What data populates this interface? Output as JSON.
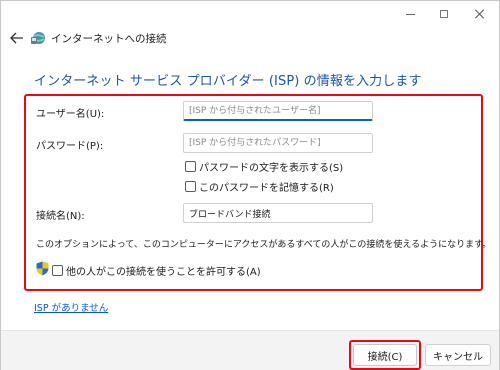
{
  "window": {
    "title": "インターネットへの接続"
  },
  "heading": "インターネット サービス プロバイダー (ISP) の情報を入力します",
  "form": {
    "username_label": "ユーザー名(U):",
    "username_placeholder": "[ISP から付与されたユーザー名]",
    "password_label": "パスワード(P):",
    "password_placeholder": "[ISP から付与されたパスワード]",
    "show_chars_label": "パスワードの文字を表示する(S)",
    "remember_label": "このパスワードを記憶する(R)",
    "connection_name_label": "接続名(N):",
    "connection_name_value": "ブロードバンド接続",
    "info_text": "このオプションによって、このコンピューターにアクセスがあるすべての人がこの接続を使えるようになります。",
    "allow_others_label": "他の人がこの接続を使うことを許可する(A)"
  },
  "no_isp_link": "ISP がありません",
  "buttons": {
    "connect": "接続(C)",
    "cancel": "キャンセル"
  },
  "colors": {
    "heading": "#1a55a8",
    "highlight": "#e8081a",
    "link": "#0a58c8"
  }
}
